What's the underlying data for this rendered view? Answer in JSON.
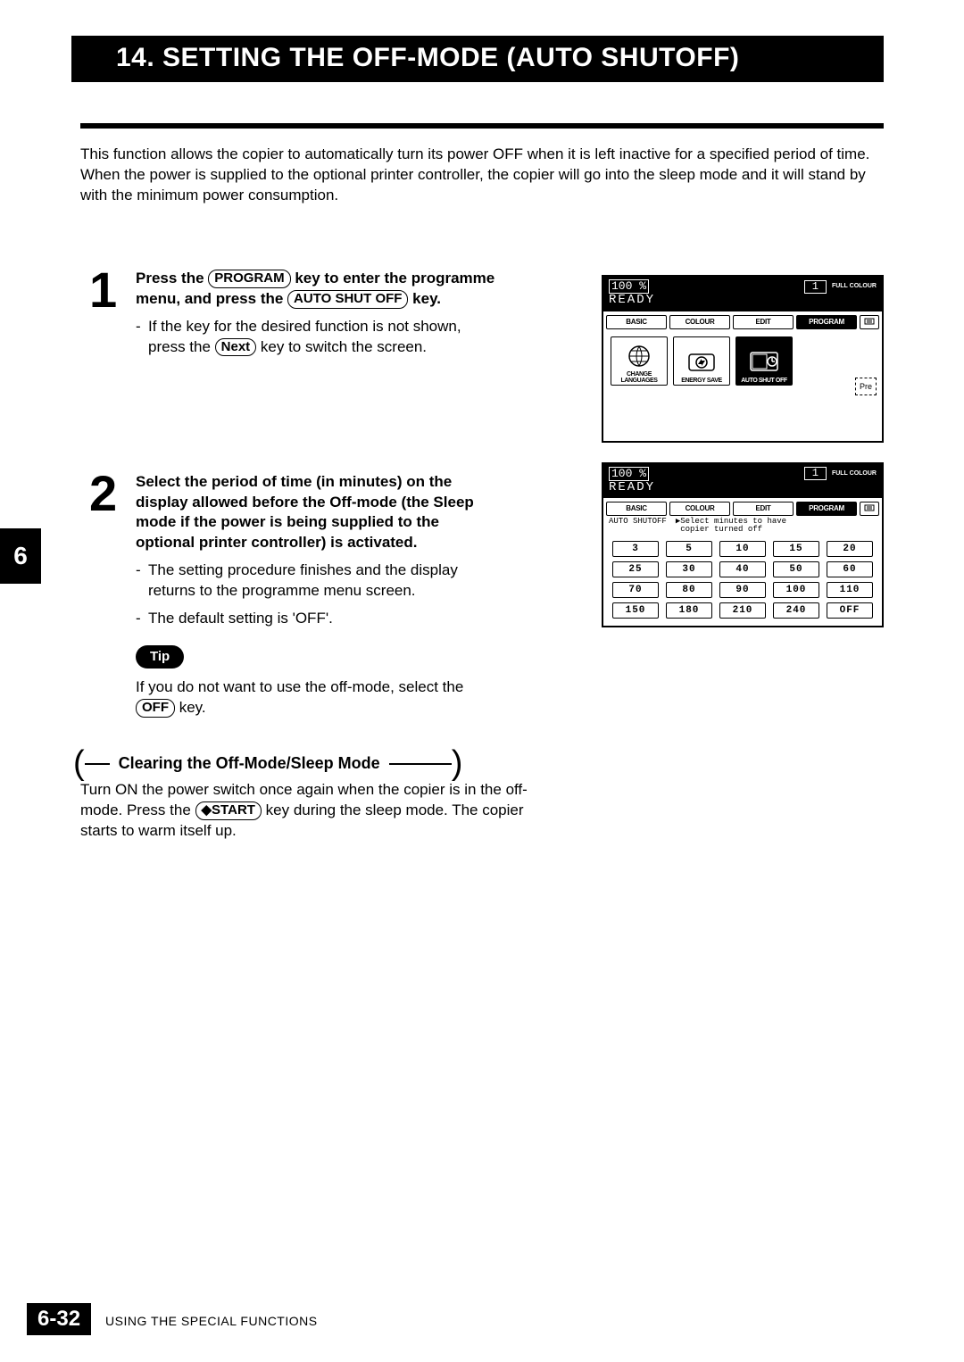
{
  "title": "14. SETTING THE OFF-MODE (AUTO SHUTOFF)",
  "intro": "This function allows the copier to automatically turn its power OFF when it is left inactive for a specified period of time. When the power is supplied to the optional printer controller, the copier will go into the sleep mode and it will stand by with the minimum power consumption.",
  "chapter_tab": "6",
  "step1": {
    "line1_pre": "Press the ",
    "key1": "PROGRAM",
    "line1_post": " key to enter the programme menu, and  press the ",
    "key2": "AUTO SHUT OFF",
    "line1_end": " key.",
    "bullet_pre": "If the key for the desired function is not shown, press the ",
    "bullet_key": "Next",
    "bullet_post": " key to switch the screen."
  },
  "step2": {
    "main": "Select the period of time (in minutes) on the display allowed before the Off-mode (the Sleep mode if the power is being supplied to the optional printer controller) is activated.",
    "b1": "The setting procedure finishes and the display returns to the programme menu screen.",
    "b2": "The default setting is 'OFF'."
  },
  "tip": {
    "label": "Tip",
    "text_pre": "If you do not want to use the off-mode, select the ",
    "key": "OFF",
    "text_post": " key."
  },
  "clearing": {
    "heading": "Clearing the Off-Mode/Sleep Mode",
    "body_pre": "Turn ON the power switch once again when the copier is in the off-mode.  Press the ",
    "key": "◆START",
    "body_post": " key during the sleep mode.  The copier starts to warm itself up."
  },
  "footer": {
    "page": "6-32",
    "section": "USING THE SPECIAL FUNCTIONS"
  },
  "lcd": {
    "percent": "100  %",
    "count": "1",
    "mode": "FULL COLOUR",
    "ready": "READY",
    "tabs": {
      "basic": "BASIC",
      "colour": "COLOUR",
      "edit": "EDIT",
      "program": "PROGRAM"
    },
    "buttons": {
      "lang": "CHANGE\nLANGUAGES",
      "energy": "ENERGY SAVE",
      "auto": "AUTO SHUT OFF",
      "pre": "Pre"
    },
    "panel2": {
      "label": "AUTO SHUTOFF",
      "instruct": "▶Select minutes to have\n copier turned off",
      "minutes": [
        "3",
        "5",
        "10",
        "15",
        "20",
        "25",
        "30",
        "40",
        "50",
        "60",
        "70",
        "80",
        "90",
        "100",
        "110",
        "150",
        "180",
        "210",
        "240",
        "OFF"
      ]
    }
  }
}
